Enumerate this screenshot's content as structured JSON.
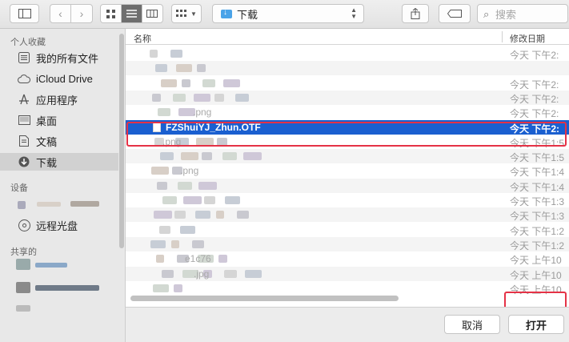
{
  "toolbar": {
    "location": "下载",
    "search_placeholder": "搜索"
  },
  "sidebar": {
    "sections": {
      "favorites": "个人收藏",
      "devices": "设备",
      "shared": "共享的"
    },
    "favorites": [
      {
        "label": "我的所有文件",
        "icon": "all-files-icon"
      },
      {
        "label": "iCloud Drive",
        "icon": "cloud-icon"
      },
      {
        "label": "应用程序",
        "icon": "applications-icon"
      },
      {
        "label": "桌面",
        "icon": "desktop-icon"
      },
      {
        "label": "文稿",
        "icon": "documents-icon"
      },
      {
        "label": "下载",
        "icon": "download-icon",
        "selected": true
      }
    ],
    "devices": [
      {
        "label": "远程光盘",
        "icon": "disc-icon"
      }
    ]
  },
  "file_list": {
    "columns": {
      "name": "名称",
      "date": "修改日期"
    },
    "rows": [
      {
        "name": "",
        "date": "今天 下午2:"
      },
      {
        "name": "",
        "date": ""
      },
      {
        "name": "",
        "date": "今天 下午2:"
      },
      {
        "name": "",
        "date": "今天 下午2:"
      },
      {
        "name": ".png",
        "date": "今天 下午2:"
      },
      {
        "name": "FZShuiYJ_Zhun.OTF",
        "date": "今天 下午2:",
        "selected": true
      },
      {
        "name": ".png",
        "date": "今天 下午1:5"
      },
      {
        "name": "",
        "date": "今天 下午1:5"
      },
      {
        "name": ".png",
        "date": "今天 下午1:4"
      },
      {
        "name": "",
        "date": "今天 下午1:4"
      },
      {
        "name": "",
        "date": "今天 下午1:3"
      },
      {
        "name": "",
        "date": "今天 下午1:3"
      },
      {
        "name": "",
        "date": "今天 下午1:2"
      },
      {
        "name": "",
        "date": "今天 下午1:2"
      },
      {
        "name": "e1c76",
        "date": "今天 上午10"
      },
      {
        "name": ".jpg",
        "date": "今天 上午10"
      },
      {
        "name": "",
        "date": "今天 上午10"
      }
    ]
  },
  "footer": {
    "cancel_label": "取消",
    "open_label": "打开"
  },
  "colors": {
    "selection": "#1a5fd0",
    "highlight": "#e53246",
    "accent_folder": "#4aa3e8"
  }
}
